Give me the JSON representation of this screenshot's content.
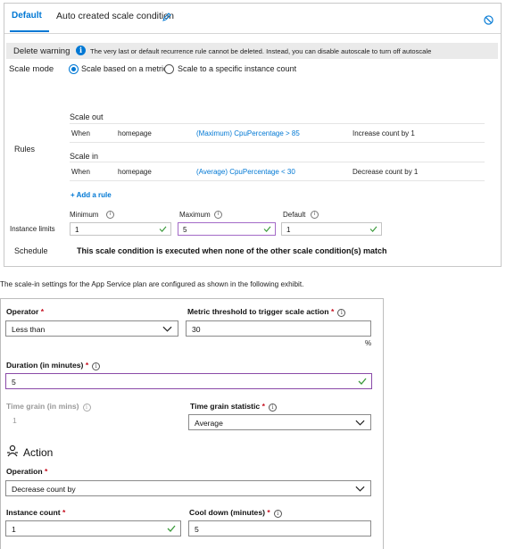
{
  "panel1": {
    "tab_label": "Default",
    "condition_name": "Auto created scale condition",
    "delete_warning": {
      "label": "Delete warning",
      "text": "The very last or default recurrence rule cannot be deleted. Instead, you can disable autoscale to turn off autoscale"
    },
    "scale_mode": {
      "label": "Scale mode",
      "options": [
        "Scale based on a metric",
        "Scale to a specific instance count"
      ],
      "selected": "Scale based on a metric"
    },
    "rules": {
      "label": "Rules",
      "scale_out": {
        "label": "Scale out",
        "when": "When",
        "resource": "homepage",
        "metric": "(Maximum) CpuPercentage > 85",
        "action": "Increase count by 1"
      },
      "scale_in": {
        "label": "Scale in",
        "when": "When",
        "resource": "homepage",
        "metric": "(Average) CpuPercentage < 30",
        "action": "Decrease count by 1"
      },
      "add_rule": "+ Add a rule"
    },
    "instance_limits": {
      "label": "Instance limits",
      "minimum_label": "Minimum",
      "minimum": "1",
      "maximum_label": "Maximum",
      "maximum": "5",
      "default_label": "Default",
      "default": "1"
    },
    "schedule": {
      "label": "Schedule",
      "text": "This scale condition is executed when none of the other scale condition(s) match"
    }
  },
  "caption": "The scale-in settings for the App Service plan are configured as shown in the following exhibit.",
  "panel2": {
    "operator": {
      "label": "Operator",
      "value": "Less than"
    },
    "threshold": {
      "label": "Metric threshold to trigger scale action",
      "value": "30",
      "unit": "%"
    },
    "duration": {
      "label": "Duration (in minutes)",
      "value": "5"
    },
    "time_grain": {
      "label": "Time grain (in mins)",
      "value": "1"
    },
    "time_grain_statistic": {
      "label": "Time grain statistic",
      "value": "Average"
    },
    "action_title": "Action",
    "operation": {
      "label": "Operation",
      "value": "Decrease count by"
    },
    "instance_count": {
      "label": "Instance count",
      "value": "1"
    },
    "cool_down": {
      "label": "Cool down (minutes)",
      "value": "5"
    },
    "required_mark": "*",
    "info_glyph": "i"
  },
  "colors": {
    "accent": "#0078d4",
    "required": "#c50f1f",
    "valid_check": "#3a9a3a",
    "focus_border": "#8a4aa8"
  },
  "icons": [
    "pencil-icon",
    "disable-icon",
    "info-icon",
    "check-icon",
    "chevron-down-icon",
    "action-person-icon"
  ]
}
